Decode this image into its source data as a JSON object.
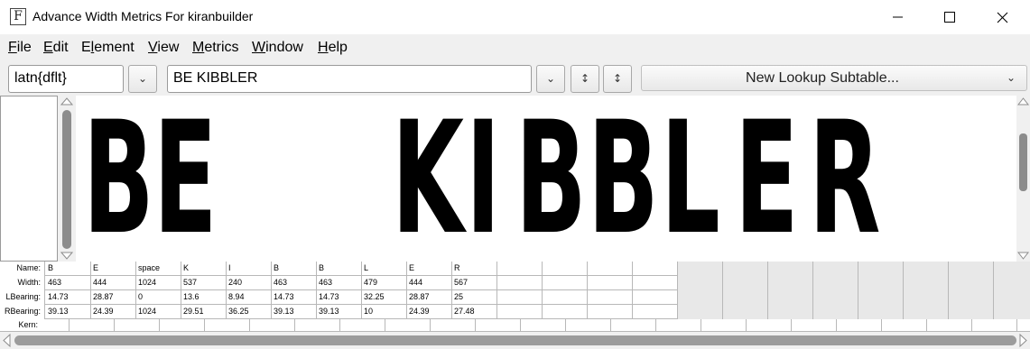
{
  "window": {
    "title": "Advance Width Metrics For kiranbuilder",
    "app_icon_glyph": "F"
  },
  "menu": [
    {
      "accel": "F",
      "rest": "ile"
    },
    {
      "accel": "E",
      "rest": "dit"
    },
    {
      "pre": "E",
      "accel": "l",
      "rest": "ement"
    },
    {
      "accel": "V",
      "rest": "iew"
    },
    {
      "accel": "M",
      "rest": "etrics"
    },
    {
      "accel": "W",
      "rest": "indow"
    },
    {
      "accel": "H",
      "rest": "elp"
    }
  ],
  "toolbar": {
    "script_lang": "latn{dflt}",
    "text_value": "BE KIBBLER",
    "lookup_subtable": "New Lookup Subtable...",
    "dropdown_glyph": "⌄",
    "vert_glyph": "↕"
  },
  "preview": {
    "letters": [
      "B",
      "E",
      "K",
      "I",
      "B",
      "B",
      "L",
      "E",
      "R"
    ]
  },
  "metrics": {
    "labels": {
      "name": "Name:",
      "width": "Width:",
      "lbearing": "LBearing:",
      "rbearing": "RBearing:",
      "kern": "Kern:"
    },
    "names": [
      "B",
      "E",
      "space",
      "K",
      "I",
      "B",
      "B",
      "L",
      "E",
      "R"
    ],
    "widths": [
      "463",
      "444",
      "1024",
      "537",
      "240",
      "463",
      "463",
      "479",
      "444",
      "567"
    ],
    "lbearings": [
      "14.73",
      "28.87",
      "0",
      "13.6",
      "8.94",
      "14.73",
      "14.73",
      "32.25",
      "28.87",
      "25"
    ],
    "rbearings": [
      "39.13",
      "24.39",
      "1024",
      "29.51",
      "36.25",
      "39.13",
      "39.13",
      "10",
      "24.39",
      "27.48"
    ]
  },
  "colors": {
    "canvas_bg": "#ffffff",
    "glyph": "#000000",
    "chrome": "#f0f0f0"
  }
}
